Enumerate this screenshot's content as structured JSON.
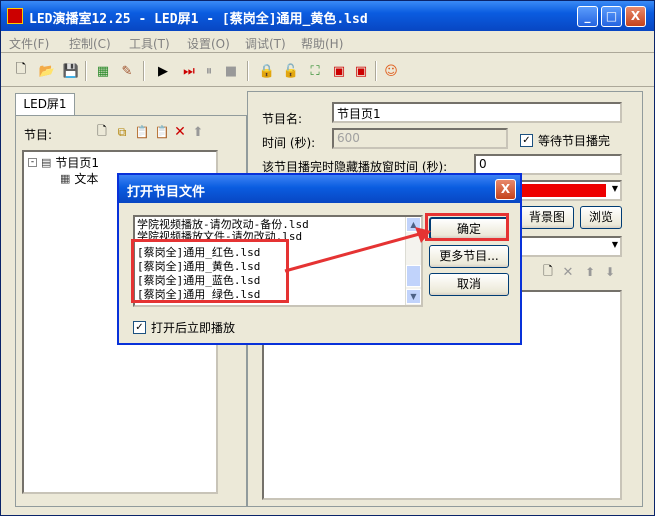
{
  "window": {
    "title": "LED演播室12.25 - LED屏1 - [蔡岗全]通用_黄色.lsd"
  },
  "title_buttons": {
    "minimize": "_",
    "maximize": "□",
    "close": "X"
  },
  "menu": [
    "文件(F)",
    "控制(C)",
    "工具(T)",
    "设置(O)",
    "调试(T)",
    "帮助(H)"
  ],
  "left_panel": {
    "tab": "LED屏1",
    "programs_label": "节目:",
    "tree": [
      {
        "label": "节目页1"
      },
      {
        "label": "文本"
      }
    ]
  },
  "right_panel": {
    "program_name_label": "节目名:",
    "program_name_value": "节目页1",
    "time_label": "时间 (秒):",
    "time_value": "600",
    "wait_label": "等待节目播完",
    "hide_label": "该节目播完时隐藏播放窗时间 (秒):",
    "hide_value": "0",
    "bg_button": "背景图",
    "browse_button": "浏览"
  },
  "dialog": {
    "title": "打开节目文件",
    "files": [
      "学院视频播放-请勿改动-备份.lsd",
      "学院视频播放文件-请勿改动.lsd",
      "[蔡岗全]通用_红色.lsd",
      "[蔡岗全]通用_黄色.lsd",
      "[蔡岗全]通用_蓝色.lsd",
      "[蔡岗全]通用_绿色.lsd"
    ],
    "ok_button": "确定",
    "more_button": "更多节目...",
    "cancel_button": "取消",
    "autoplay_label": "打开后立即播放"
  },
  "colors": {
    "accent": "#0a5ce0",
    "highlight": "#e53333",
    "color_field": "#ee0000"
  }
}
